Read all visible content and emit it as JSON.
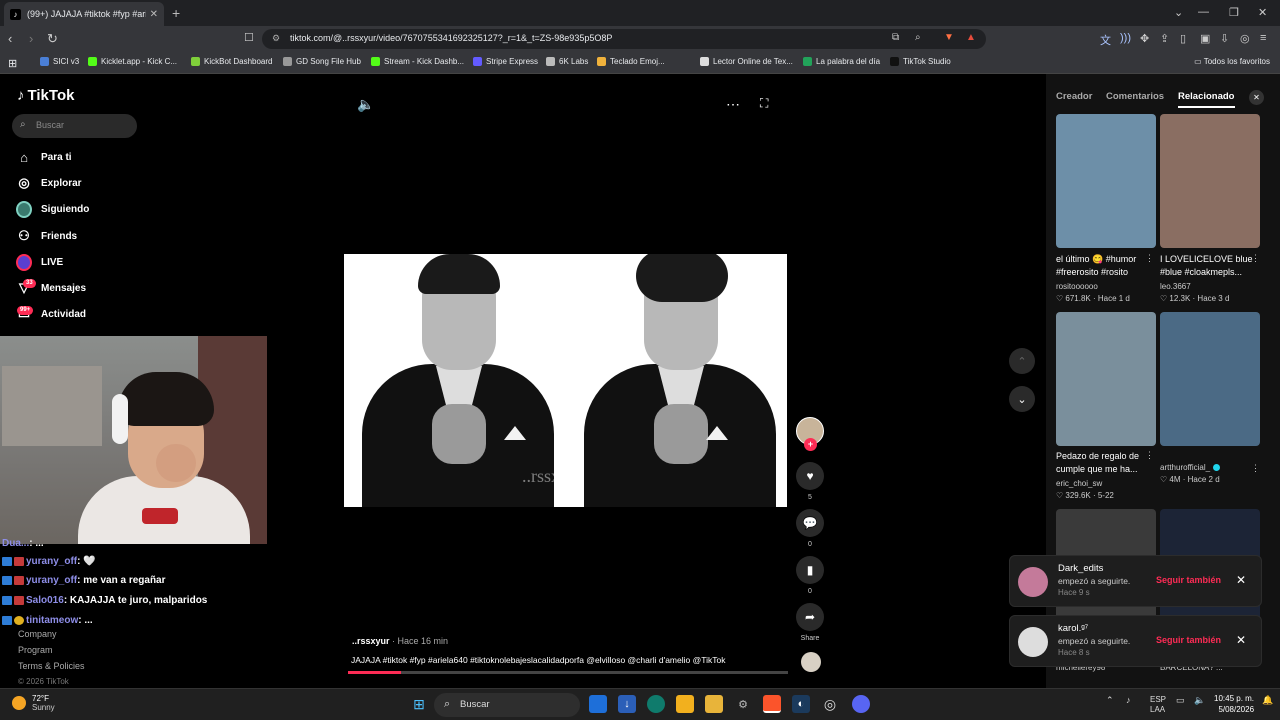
{
  "browser": {
    "tab_title": "(99+) JAJAJA #tiktok #fyp #ari",
    "url": "tiktok.com/@..rssxyur/video/7670755341692325127?_r=1&_t=ZS-98e935p5O8P",
    "bookmarks": [
      {
        "label": "SICI v3",
        "color": "#4a7fd6"
      },
      {
        "label": "Kicklet.app - Kick C...",
        "color": "#53fc18"
      },
      {
        "label": "KickBot Dashboard",
        "color": "#7fcf3a"
      },
      {
        "label": "GD Song File Hub",
        "color": "#999999"
      },
      {
        "label": "Stream - Kick Dashb...",
        "color": "#53fc18"
      },
      {
        "label": "Stripe Express",
        "color": "#635bff"
      },
      {
        "label": "6K Labs",
        "color": "#bbbbbb"
      },
      {
        "label": "Teclado Emoj...",
        "color": "#f0b23c"
      },
      {
        "label": "Lector Online de Tex...",
        "color": "#dddddd"
      },
      {
        "label": "La palabra del día",
        "color": "#22a35a"
      },
      {
        "label": "TikTok Studio",
        "color": "#111111"
      }
    ],
    "all_bookmarks": "Todos los favoritos"
  },
  "sidebar": {
    "logo": "TikTok",
    "search_placeholder": "Buscar",
    "nav": [
      {
        "label": "Para ti",
        "icon": "home-icon"
      },
      {
        "label": "Explorar",
        "icon": "compass-icon"
      },
      {
        "label": "Siguiendo",
        "icon": "following-avatar-icon"
      },
      {
        "label": "Friends",
        "icon": "friends-icon"
      },
      {
        "label": "LIVE",
        "icon": "live-icon"
      },
      {
        "label": "Mensajes",
        "icon": "messages-icon",
        "badge": "33"
      },
      {
        "label": "Actividad",
        "icon": "activity-icon",
        "badge": "99+"
      }
    ],
    "footer": [
      "Company",
      "Program",
      "Terms & Policies",
      "© 2026 TikTok"
    ]
  },
  "chat": [
    {
      "user": "Dua...",
      "msg": ": ..."
    },
    {
      "user": "yurany_off",
      "msg": ": 🤍"
    },
    {
      "user": "yurany_off",
      "msg": ": me van a regañar"
    },
    {
      "user": "Salo016",
      "msg": ": KAJAJJA te juro, malparidos"
    },
    {
      "user": "tinitameow",
      "msg": ": ..."
    }
  ],
  "video": {
    "author": "..rssxyur",
    "time": "Hace 16 min",
    "description": "JAJAJA #tiktok #fyp #ariela640 #tiktoknolebajeslacalidadporfa @elvilloso @charli d'amelio @TikTok",
    "watermark": "..rssxyur",
    "progress": 0.12,
    "likes": "5",
    "comments": "0",
    "saves": "0",
    "share_label": "Share"
  },
  "panel": {
    "tabs": [
      "Creador",
      "Comentarios",
      "Relacionado"
    ],
    "cards": [
      {
        "title": "el último 😋 #humor #freerosito #rosito",
        "user": "rositoooooo",
        "stats": "♡ 671.8K · Hace 1 d",
        "thumb": "#6d8fa8",
        "verified": false
      },
      {
        "title": "I LOVELICELOVE blue #blue #cloakmepls...",
        "user": "leo.3667",
        "stats": "♡ 12.3K · Hace 3 d",
        "thumb": "#8a6e62",
        "verified": false
      },
      {
        "title": "Pedazo de regalo de cumple que me ha...",
        "user": "eric_choi_sw",
        "stats": "♡ 329.6K · 5-22",
        "thumb": "#7a8f9c",
        "verified": false
      },
      {
        "title": "",
        "user": "artthurofficial_",
        "stats": "♡ 4M · Hace 2 d",
        "thumb": "#4b6a85",
        "verified": true
      }
    ],
    "more_cards_users": [
      "michellerey98",
      "BARCELONA? ..."
    ]
  },
  "notifications": [
    {
      "name": "Dark_edits",
      "text": "empezó a seguirte.",
      "time": "Hace 9 s",
      "action": "Seguir también",
      "avatar": "#c47a9a"
    },
    {
      "name": "karol.ᵍ⁷",
      "text": "empezó a seguirte.",
      "time": "Hace 8 s",
      "action": "Seguir también",
      "avatar": "#dddddd"
    }
  ],
  "taskbar": {
    "temp": "72°F",
    "weather": "Sunny",
    "search": "Buscar",
    "lang1": "ESP",
    "lang2": "LAA",
    "time": "10:45 p. m.",
    "date": "5/08/2026"
  }
}
